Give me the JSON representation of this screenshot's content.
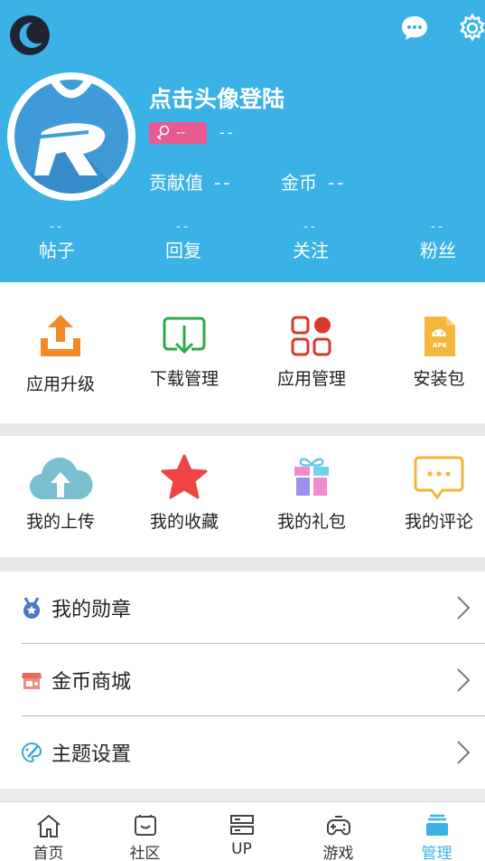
{
  "header": {
    "username": "点击头像登陆",
    "level_badge": "--",
    "level_text": "--",
    "contribution_label": "贡献值",
    "contribution_value": "--",
    "coins_label": "金币",
    "coins_value": "--",
    "stats": [
      {
        "label": "帖子",
        "value": "--"
      },
      {
        "label": "回复",
        "value": "--"
      },
      {
        "label": "关注",
        "value": "--"
      },
      {
        "label": "粉丝",
        "value": "--"
      }
    ],
    "apk_icon_text": "APK"
  },
  "tools": [
    {
      "label": "应用升级",
      "icon": "upload-tray-icon"
    },
    {
      "label": "下载管理",
      "icon": "download-icon"
    },
    {
      "label": "应用管理",
      "icon": "app-grid-icon"
    },
    {
      "label": "安装包",
      "icon": "apk-icon"
    }
  ],
  "personal": [
    {
      "label": "我的上传",
      "icon": "cloud-upload-icon"
    },
    {
      "label": "我的收藏",
      "icon": "star-icon"
    },
    {
      "label": "我的礼包",
      "icon": "gift-icon"
    },
    {
      "label": "我的评论",
      "icon": "comment-icon"
    }
  ],
  "menu": [
    {
      "label": "我的勋章",
      "icon": "medal-icon"
    },
    {
      "label": "金币商城",
      "icon": "shop-icon"
    },
    {
      "label": "主题设置",
      "icon": "palette-icon"
    }
  ],
  "nav": [
    {
      "label": "首页",
      "icon": "home-icon"
    },
    {
      "label": "社区",
      "icon": "community-icon"
    },
    {
      "label": "UP",
      "icon": "up-icon"
    },
    {
      "label": "游戏",
      "icon": "gamepad-icon"
    },
    {
      "label": "管理",
      "icon": "manage-icon",
      "active": true
    }
  ],
  "colors": {
    "header_bg": "#3ab2e6",
    "badge_pink": "#e8598f",
    "active_tab": "#3ab2e6"
  }
}
